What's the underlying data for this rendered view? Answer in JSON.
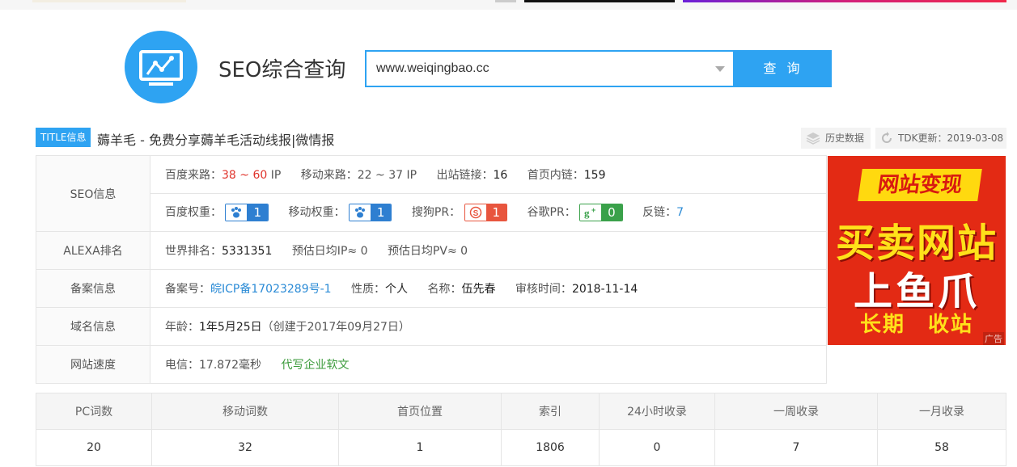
{
  "header": {
    "brand": "SEO综合查询",
    "search_value": "www.weiqingbao.cc",
    "search_button": "查 询"
  },
  "title_row": {
    "badge": "TITLE信息",
    "title": "薅羊毛 - 免费分享薅羊毛活动线报|微情报",
    "history_label": "历史数据",
    "tdk_label": "TDK更新：2019-03-08"
  },
  "seo_info": {
    "label": "SEO信息",
    "baidu_traffic_label": "百度来路：",
    "baidu_traffic_value": "38 ~ 60",
    "baidu_traffic_unit": " IP",
    "mobile_traffic_label": "移动来路：",
    "mobile_traffic_value": "22 ~ 37 IP",
    "outlinks_label": "出站链接：",
    "outlinks_value": "16",
    "inlinks_label": "首页内链：",
    "inlinks_value": "159",
    "baidu_rank_label": "百度权重：",
    "baidu_rank_value": "1",
    "mobile_rank_label": "移动权重：",
    "mobile_rank_value": "1",
    "sogou_pr_label": "搜狗PR：",
    "sogou_pr_value": "1",
    "google_pr_label": "谷歌PR：",
    "google_pr_value": "0",
    "backlinks_label": "反链：",
    "backlinks_value": "7"
  },
  "alexa": {
    "label": "ALEXA排名",
    "world_rank_label": "世界排名：",
    "world_rank_value": "5331351",
    "daily_ip": "预估日均IP≈ 0",
    "daily_pv": "预估日均PV≈ 0"
  },
  "icp": {
    "label": "备案信息",
    "number_label": "备案号：",
    "number_value": "皖ICP备17023289号-1",
    "type_label": "性质：",
    "type_value": "个人",
    "name_label": "名称：",
    "name_value": "伍先春",
    "date_label": "审核时间：",
    "date_value": "2018-11-14"
  },
  "domain": {
    "label": "域名信息",
    "age_label": "年龄：",
    "age_value": "1年5月25日",
    "created": "（创建于2017年09月27日）"
  },
  "speed": {
    "label": "网站速度",
    "telecom": "电信：17.872毫秒",
    "link": "代写企业软文"
  },
  "ad": {
    "banner": "网站变现",
    "line1": "买卖网站",
    "line2": "上鱼爪",
    "line3": "长期　收站",
    "tag": "广告"
  },
  "stats": {
    "headers": [
      "PC词数",
      "移动词数",
      "首页位置",
      "索引",
      "24小时收录",
      "一周收录",
      "一月收录"
    ],
    "values": [
      "20",
      "32",
      "1",
      "1806",
      "0",
      "7",
      "58"
    ]
  },
  "colors": {
    "accent": "#2ea3f2",
    "red": "#e0332b",
    "link_blue": "#2b8bd6",
    "green": "#3a9a3a"
  }
}
